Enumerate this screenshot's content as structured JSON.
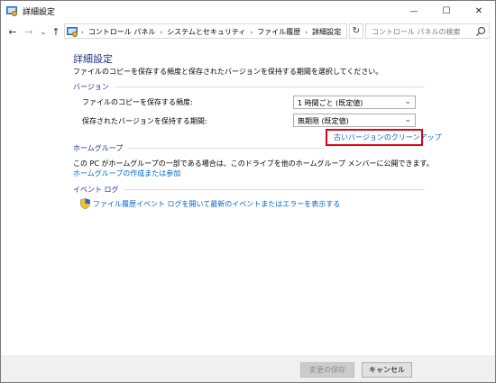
{
  "window": {
    "title": "詳細設定"
  },
  "title_controls": {
    "minimize": "—",
    "maximize": "☐",
    "close": "✕"
  },
  "nav": {
    "back": "←",
    "forward": "→",
    "recent": "⌄",
    "up": "↑"
  },
  "address": {
    "crumbs": [
      "コントロール パネル",
      "システムとセキュリティ",
      "ファイル履歴",
      "詳細設定"
    ],
    "separator": "›",
    "dropdown": "⌄",
    "refresh": "↻"
  },
  "search": {
    "placeholder": "コントロール パネルの検索"
  },
  "main": {
    "title": "詳細設定",
    "description": "ファイルのコピーを保存する頻度と保存されたバージョンを保持する期間を選択してください。",
    "versions": {
      "heading": "バージョン",
      "frequency_label": "ファイルのコピーを保存する頻度:",
      "frequency_value": "1 時間ごと (既定値)",
      "retention_label": "保存されたバージョンを保持する期間:",
      "retention_value": "無期限 (既定値)",
      "cleanup_link": "古いバージョンのクリーンアップ"
    },
    "homegroup": {
      "heading": "ホームグループ",
      "text": "この PC がホームグループの一部である場合は、このドライブを他のホームグループ メンバーに公開できます。",
      "link": "ホームグループの作成または参加"
    },
    "eventlog": {
      "heading": "イベント ログ",
      "link": "ファイル履歴イベント ログを開いて最新のイベントまたはエラーを表示する"
    }
  },
  "footer": {
    "save_label": "変更の保存",
    "cancel_label": "キャンセル"
  },
  "colors": {
    "heading": "#1e3287",
    "link": "#0066cc",
    "highlight": "#e60012"
  }
}
